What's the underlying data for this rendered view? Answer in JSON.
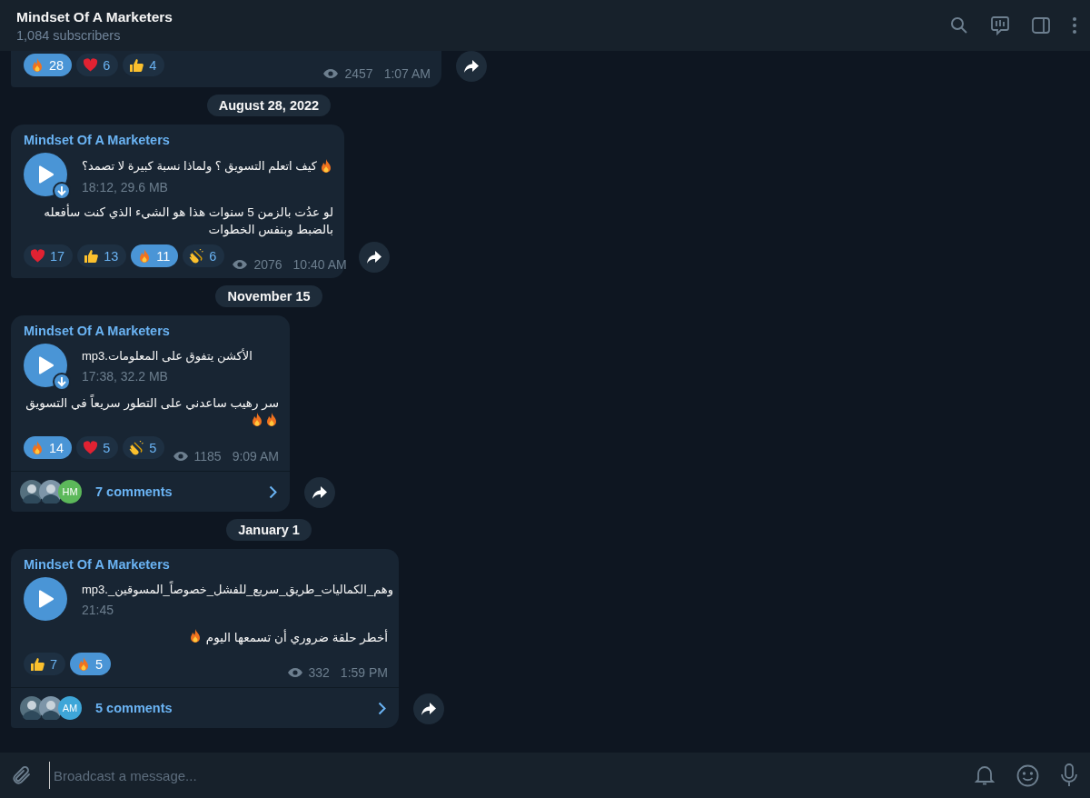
{
  "channel": {
    "title": "Mindset Of A Marketers",
    "subtitle": "1,084 subscribers"
  },
  "messages": [
    {
      "kind": "message",
      "reactions": [
        {
          "kind": "fire",
          "count": "28",
          "selected": true
        },
        {
          "kind": "heart",
          "count": "6",
          "selected": false
        },
        {
          "kind": "thumbs",
          "count": "4",
          "selected": false
        }
      ],
      "views": "2457",
      "time": "1:07 AM"
    },
    {
      "kind": "date",
      "label": "August 28, 2022"
    },
    {
      "kind": "message",
      "sender": "Mindset Of A Marketers",
      "audio": {
        "title": "كيف اتعلم التسويق ؟ ولماذا نسبة كبيرة لا تصمد؟",
        "title_emoji": [
          {
            "kind": "fire"
          }
        ],
        "info": "18:12, 29.6 MB",
        "downloaded": false
      },
      "caption": {
        "text": "لو عدُت بالزمن 5 سنوات هذا هو الشيء الذي كنت سأفعله بالضبط وبنفس الخطوات"
      },
      "reactions": [
        {
          "kind": "heart",
          "count": "17",
          "selected": false
        },
        {
          "kind": "thumbs",
          "count": "13",
          "selected": false
        },
        {
          "kind": "fire",
          "count": "11",
          "selected": true
        },
        {
          "kind": "clap",
          "count": "6",
          "selected": false
        }
      ],
      "views": "2076",
      "time": "10:40 AM"
    },
    {
      "kind": "date",
      "label": "November 15"
    },
    {
      "kind": "message",
      "sender": "Mindset Of A Marketers",
      "audio": {
        "title": "الأكشن يتفوق على المعلومات.mp3",
        "info": "17:38, 32.2 MB",
        "downloaded": false
      },
      "caption": {
        "text": "سر رهيب ساعدني على التطور سريعاً في التسويق",
        "emoji": [
          {
            "kind": "fire"
          },
          {
            "kind": "fire"
          }
        ]
      },
      "reactions": [
        {
          "kind": "fire",
          "count": "14",
          "selected": true
        },
        {
          "kind": "heart",
          "count": "5",
          "selected": false
        },
        {
          "kind": "clap",
          "count": "5",
          "selected": false
        }
      ],
      "views": "1185",
      "time": "9:09 AM",
      "comments": {
        "label": "7 comments",
        "avatars": [
          {
            "kind": "photo"
          },
          {
            "kind": "photo"
          },
          {
            "kind": "initials",
            "text": "HM",
            "color": "#5cb85a"
          }
        ]
      }
    },
    {
      "kind": "date",
      "label": "January 1"
    },
    {
      "kind": "message",
      "sender": "Mindset Of A Marketers",
      "audio": {
        "title": "وهم_الكماليات_طريق_سريع_للفشل_خصوصاً_المسوقين_.mp3",
        "info": "21:45",
        "downloaded": true
      },
      "caption": {
        "text": "أخطر حلقة ضروري أن تسمعها اليوم",
        "emoji": [
          {
            "kind": "fire"
          }
        ]
      },
      "reactions": [
        {
          "kind": "thumbs",
          "count": "7",
          "selected": false
        },
        {
          "kind": "fire",
          "count": "5",
          "selected": true
        }
      ],
      "views": "332",
      "time": "1:59 PM",
      "comments": {
        "label": "5 comments",
        "avatars": [
          {
            "kind": "photo"
          },
          {
            "kind": "photo"
          },
          {
            "kind": "initials",
            "text": "AM",
            "color": "#3ea6d8"
          }
        ]
      }
    }
  ],
  "composer": {
    "placeholder": "Broadcast a message..."
  }
}
